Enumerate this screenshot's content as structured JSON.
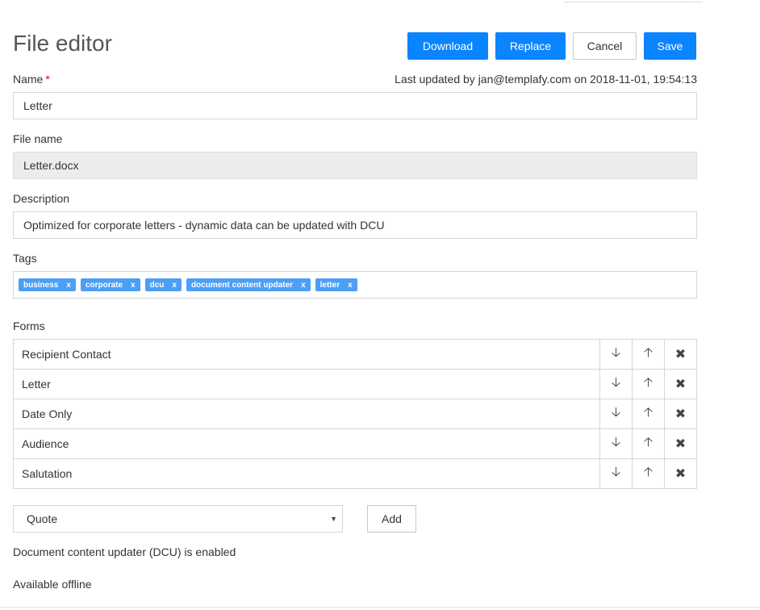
{
  "page": {
    "title": "File editor"
  },
  "toolbar": {
    "download_label": "Download",
    "replace_label": "Replace",
    "cancel_label": "Cancel",
    "save_label": "Save",
    "accent_color": "#0a84ff"
  },
  "name": {
    "label": "Name",
    "required_mark": "*",
    "value": "Letter"
  },
  "last_updated": "Last updated by jan@templafy.com on 2018-11-01, 19:54:13",
  "file_name": {
    "label": "File name",
    "value": "Letter.docx"
  },
  "description": {
    "label": "Description",
    "value": "Optimized for corporate letters - dynamic data can be updated with DCU"
  },
  "tags": {
    "label": "Tags",
    "remove_glyph": "x",
    "items": [
      "business",
      "corporate",
      "dcu",
      "document content updater",
      "letter"
    ]
  },
  "forms": {
    "label": "Forms",
    "rows": [
      "Recipient Contact",
      "Letter",
      "Date Only",
      "Audience",
      "Salutation"
    ],
    "move_down_icon": "arrow-down-icon",
    "move_up_icon": "arrow-up-icon",
    "remove_icon": "close-icon"
  },
  "form_select": {
    "selected": "Quote",
    "add_label": "Add"
  },
  "dcu_status": "Document content updater (DCU) is enabled",
  "offline": "Available offline"
}
